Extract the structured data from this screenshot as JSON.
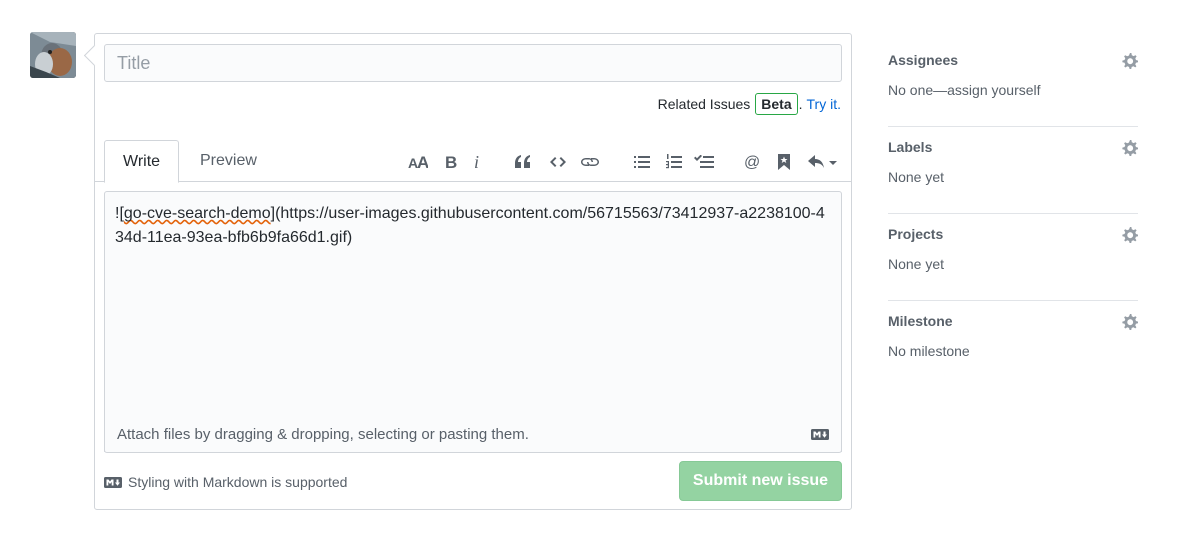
{
  "title_input": {
    "placeholder": "Title",
    "value": ""
  },
  "related": {
    "label": "Related Issues",
    "badge": "Beta",
    "dot": ".",
    "link": "Try it."
  },
  "tabs": {
    "write": "Write",
    "preview": "Preview"
  },
  "toolbar": [
    "text-size-icon",
    "bold-icon",
    "italic-icon",
    "quote-icon",
    "code-icon",
    "link-icon",
    "unordered-list-icon",
    "ordered-list-icon",
    "task-list-icon",
    "mention-icon",
    "bookmark-icon",
    "reply-icon"
  ],
  "editor": {
    "prefix": "![",
    "alt": "go-cve-search-demo",
    "suffix": "](https://user-images.githubusercontent.com/56715563/73412937-a2238100-434d-11ea-93ea-bfb6b9fa66d1.gif)"
  },
  "attach": {
    "text": "Attach files by dragging & dropping, selecting or pasting them."
  },
  "markdown_note": "Styling with Markdown is supported",
  "submit_label": "Submit new issue",
  "sidebar": {
    "assignees": {
      "title": "Assignees",
      "value": "No one—assign yourself"
    },
    "labels": {
      "title": "Labels",
      "value": "None yet"
    },
    "projects": {
      "title": "Projects",
      "value": "None yet"
    },
    "milestone": {
      "title": "Milestone",
      "value": "No milestone"
    }
  },
  "colors": {
    "link": "#0366d6",
    "beta_border": "#28a745",
    "submit_bg": "#94d3a2"
  }
}
